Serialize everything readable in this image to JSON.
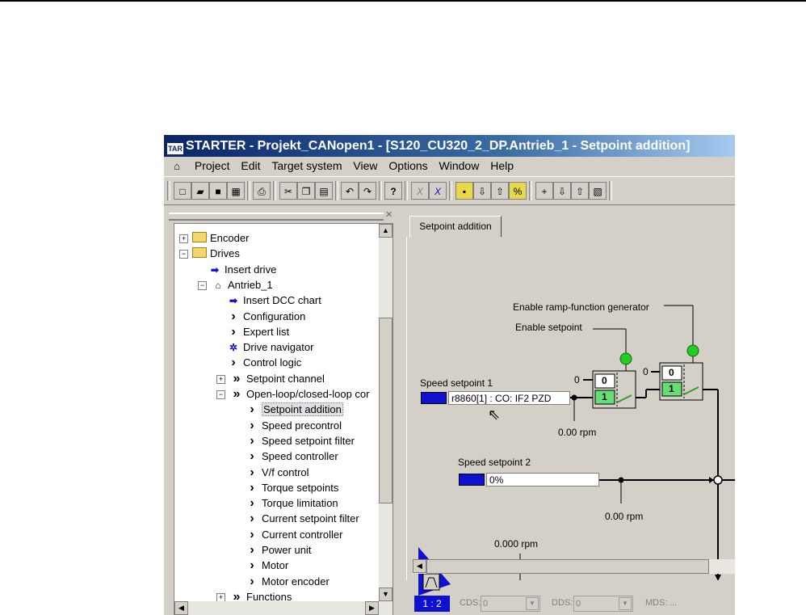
{
  "window": {
    "title": "STARTER - Projekt_CANopen1 - [S120_CU320_2_DP.Antrieb_1 - Setpoint addition]",
    "app_badge": "TAR"
  },
  "menu": [
    "Project",
    "Edit",
    "Target system",
    "View",
    "Options",
    "Window",
    "Help"
  ],
  "tree": [
    {
      "label": "Encoder",
      "icon": "folder-icon",
      "expander": "+"
    },
    {
      "label": "Drives",
      "icon": "folder-icon",
      "expander": "-"
    },
    {
      "label": "Insert drive",
      "icon": "insert-icon"
    },
    {
      "label": "Antrieb_1",
      "icon": "drive-icon",
      "expander": "-"
    },
    {
      "label": "Insert DCC chart",
      "icon": "insert-icon"
    },
    {
      "label": "Configuration",
      "icon": "chevron-icon"
    },
    {
      "label": "Expert list",
      "icon": "chevron-icon"
    },
    {
      "label": "Drive navigator",
      "icon": "navigator-icon"
    },
    {
      "label": "Control logic",
      "icon": "chevron-icon"
    },
    {
      "label": "Setpoint channel",
      "icon": "double-chevron-icon",
      "expander": "+"
    },
    {
      "label": "Open-loop/closed-loop cor",
      "icon": "double-chevron-icon",
      "expander": "-"
    },
    {
      "label": "Setpoint addition",
      "icon": "chevron-icon",
      "selected": true
    },
    {
      "label": "Speed precontrol",
      "icon": "chevron-icon"
    },
    {
      "label": "Speed setpoint filter",
      "icon": "chevron-icon"
    },
    {
      "label": "Speed controller",
      "icon": "chevron-icon"
    },
    {
      "label": "V/f control",
      "icon": "chevron-icon"
    },
    {
      "label": "Torque setpoints",
      "icon": "chevron-icon"
    },
    {
      "label": "Torque limitation",
      "icon": "chevron-icon"
    },
    {
      "label": "Current setpoint filter",
      "icon": "chevron-icon"
    },
    {
      "label": "Current controller",
      "icon": "chevron-icon"
    },
    {
      "label": "Power unit",
      "icon": "chevron-icon"
    },
    {
      "label": "Motor",
      "icon": "chevron-icon"
    },
    {
      "label": "Motor encoder",
      "icon": "chevron-icon"
    },
    {
      "label": "Functions",
      "icon": "double-chevron-icon",
      "expander": "+"
    }
  ],
  "tab": {
    "label": "Setpoint addition"
  },
  "diagram": {
    "enable_ramp": "Enable ramp-function generator",
    "enable_setpoint": "Enable setpoint",
    "speed_setpoint_1": "Speed setpoint 1",
    "speed_setpoint_1_value": "r8860[1] : CO: IF2 PZD",
    "speed_setpoint_2": "Speed setpoint 2",
    "speed_setpoint_2_value": "0%",
    "rpm_1": "0.00 rpm",
    "rpm_2": "0.00 rpm",
    "rpm_3": "0.000 rpm",
    "zero": "0",
    "switch_0": "0",
    "switch_1": "1"
  },
  "status": {
    "badge": "1 : 2",
    "cds_label": "CDS:",
    "cds_value": "0",
    "dds_label": "DDS:",
    "dds_value": "0",
    "mds_label": "MDS:",
    "mds_value": "..."
  },
  "colors": {
    "led": "#22cc22",
    "connector": "#1010d0",
    "switch_active": "#66dd77"
  }
}
